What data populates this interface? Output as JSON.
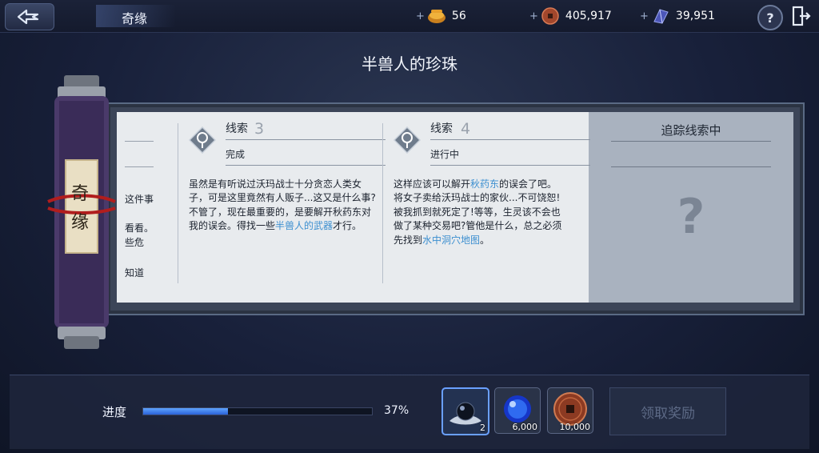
{
  "header": {
    "title": "奇缘",
    "resources": [
      {
        "icon": "gold-coin-pouch-icon",
        "value": "56"
      },
      {
        "icon": "copper-coin-icon",
        "value": "405,917"
      },
      {
        "icon": "blue-crystal-icon",
        "value": "39,951"
      }
    ],
    "plus": "+",
    "help": "?"
  },
  "quest": {
    "title": "半兽人的珍珠",
    "scroll_label_1": "奇",
    "scroll_label_2": "缘",
    "left_fragments": [
      "这件事",
      "看看。",
      "些危",
      "知道"
    ]
  },
  "clues": [
    {
      "label": "线索",
      "number": "3",
      "status": "完成",
      "text_before": "虽然是有听说过沃玛战士十分贪恋人类女子，可是这里竟然有人贩子...这又是什么事?不管了，现在最重要的，是要解开秋药东对我的误会。得找一些",
      "highlight": "半兽人的武器",
      "text_after": "才行。"
    },
    {
      "label": "线索",
      "number": "4",
      "status": "进行中",
      "text_before": "这样应该可以解开",
      "highlight": "秋药东",
      "text_middle": "的误会了吧。将女子卖给沃玛战士的家伙...不可饶恕!被我抓到就死定了!等等，生灵该不会也做了某种交易吧?管他是什么，总之必须先找到",
      "highlight2": "水中洞穴地图",
      "text_after": "。"
    }
  ],
  "tracking": {
    "title": "追踪线索中",
    "unknown": "?"
  },
  "progress": {
    "label": "进度",
    "percent_text": "37%",
    "fraction": 0.37
  },
  "rewards": [
    {
      "icon": "black-pearl-icon",
      "count": "2"
    },
    {
      "icon": "blue-orb-icon",
      "count": "6,000"
    },
    {
      "icon": "copper-coin-icon",
      "count": "10,000"
    }
  ],
  "claim_button": "领取奖励",
  "colors": {
    "highlight": "#3c8fd0",
    "progress_fill": "#3f7ff0",
    "claim_disabled_text": "#5d6a86"
  }
}
